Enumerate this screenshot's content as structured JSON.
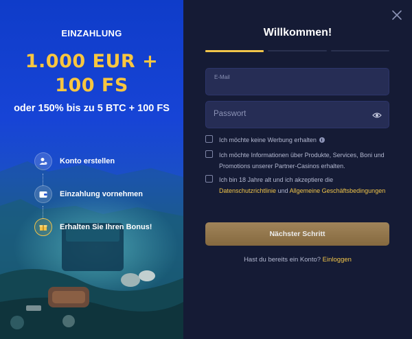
{
  "promo": {
    "kicker": "EINZAHLUNG",
    "amount_line1": "1.000 EUR +",
    "amount_line2": "100 FS",
    "subtitle": "oder 150% bis zu 5 BTC + 100 FS",
    "steps": [
      {
        "label": "Konto erstellen",
        "icon": "user-icon"
      },
      {
        "label": "Einzahlung vornehmen",
        "icon": "wallet-icon"
      },
      {
        "label": "Erhalten Sie Ihren Bonus!",
        "icon": "gift-icon"
      }
    ],
    "accent_color": "#f8c640"
  },
  "form": {
    "title": "Willkommen!",
    "progress_steps": 3,
    "progress_active": 1,
    "email_label": "E-Mail",
    "email_value": "",
    "password_placeholder": "Passwort",
    "checks": {
      "no_ads": "Ich möchte keine Werbung erhalten",
      "partner_info": "Ich möchte Informationen über Produkte, Services, Boni und Promotions unserer Partner-Casinos erhalten.",
      "age_prefix": "Ich bin 18 Jahre alt und ich akzeptiere die",
      "privacy_link": "Datenschutzrichtlinie",
      "and": "und",
      "terms_link": "Allgemeine Geschäftsbedingungen"
    },
    "submit_label": "Nächster Schritt",
    "login_prompt": "Hast du bereits ein Konto?",
    "login_link": "Einloggen",
    "link_color": "#f1c54a"
  }
}
